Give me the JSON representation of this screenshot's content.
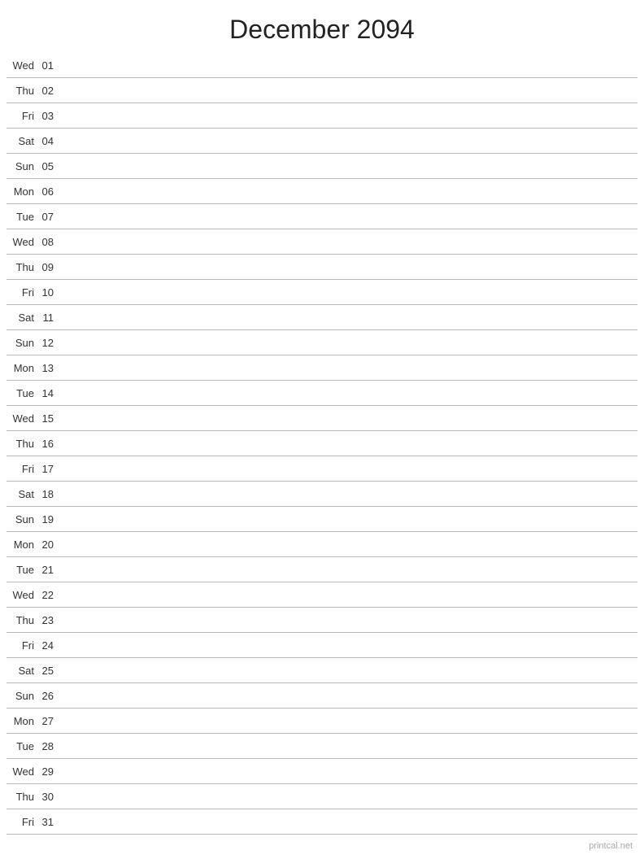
{
  "title": "December 2094",
  "footer": "printcal.net",
  "days": [
    {
      "name": "Wed",
      "number": "01"
    },
    {
      "name": "Thu",
      "number": "02"
    },
    {
      "name": "Fri",
      "number": "03"
    },
    {
      "name": "Sat",
      "number": "04"
    },
    {
      "name": "Sun",
      "number": "05"
    },
    {
      "name": "Mon",
      "number": "06"
    },
    {
      "name": "Tue",
      "number": "07"
    },
    {
      "name": "Wed",
      "number": "08"
    },
    {
      "name": "Thu",
      "number": "09"
    },
    {
      "name": "Fri",
      "number": "10"
    },
    {
      "name": "Sat",
      "number": "11"
    },
    {
      "name": "Sun",
      "number": "12"
    },
    {
      "name": "Mon",
      "number": "13"
    },
    {
      "name": "Tue",
      "number": "14"
    },
    {
      "name": "Wed",
      "number": "15"
    },
    {
      "name": "Thu",
      "number": "16"
    },
    {
      "name": "Fri",
      "number": "17"
    },
    {
      "name": "Sat",
      "number": "18"
    },
    {
      "name": "Sun",
      "number": "19"
    },
    {
      "name": "Mon",
      "number": "20"
    },
    {
      "name": "Tue",
      "number": "21"
    },
    {
      "name": "Wed",
      "number": "22"
    },
    {
      "name": "Thu",
      "number": "23"
    },
    {
      "name": "Fri",
      "number": "24"
    },
    {
      "name": "Sat",
      "number": "25"
    },
    {
      "name": "Sun",
      "number": "26"
    },
    {
      "name": "Mon",
      "number": "27"
    },
    {
      "name": "Tue",
      "number": "28"
    },
    {
      "name": "Wed",
      "number": "29"
    },
    {
      "name": "Thu",
      "number": "30"
    },
    {
      "name": "Fri",
      "number": "31"
    }
  ]
}
